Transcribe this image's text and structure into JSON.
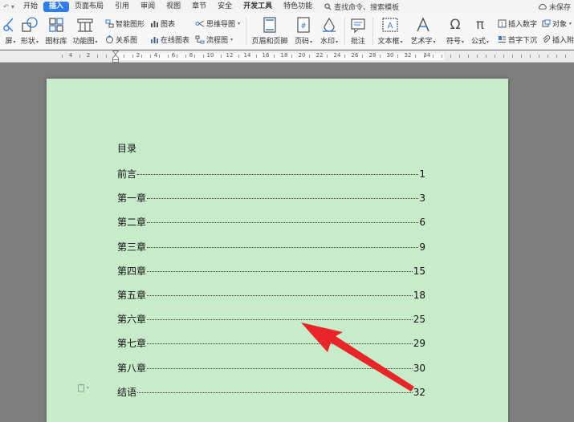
{
  "menubar": {
    "tabs": [
      "开始",
      "插入",
      "页面布局",
      "引用",
      "审阅",
      "视图",
      "章节",
      "安全",
      "开发工具",
      "特色功能"
    ],
    "active_tab": "插入",
    "search_placeholder": "查找命令、搜索模板",
    "save_state": "未保存"
  },
  "ribbon": {
    "screenshot": "屏",
    "shape": "形状",
    "icon_lib": "图标库",
    "func_chart": "功能图",
    "smart_art": "智能图形",
    "relation": "关系图",
    "chart": "图表",
    "online_chart": "在线图表",
    "mind_map": "思维导图",
    "flow_chart": "流程图",
    "header_footer": "页眉和页脚",
    "page_num": "页码",
    "watermark": "水印",
    "comment": "批注",
    "textbox": "文本框",
    "wordart": "艺术字",
    "symbol": "符号",
    "formula": "公式",
    "insert_number": "插入数字",
    "drop_cap": "首字下沉",
    "object": "对象",
    "insert_attach": "插入附"
  },
  "ruler": {
    "labels": [
      "4",
      "2",
      "2",
      "4",
      "6",
      "8",
      "10",
      "12",
      "14",
      "16",
      "18",
      "20",
      "22",
      "24",
      "26",
      "28",
      "30",
      "32",
      "34"
    ]
  },
  "document": {
    "toc_title": "目录",
    "entries": [
      {
        "chapter": "前言",
        "page": "1"
      },
      {
        "chapter": "第一章",
        "page": "3"
      },
      {
        "chapter": "第二章",
        "page": "6"
      },
      {
        "chapter": "第三章",
        "page": "9"
      },
      {
        "chapter": "第四章",
        "page": "15"
      },
      {
        "chapter": "第五章",
        "page": "18"
      },
      {
        "chapter": "第六章",
        "page": "25"
      },
      {
        "chapter": "第七章",
        "page": "29"
      },
      {
        "chapter": "第八章",
        "page": "30"
      },
      {
        "chapter": "结语",
        "page": "32"
      }
    ]
  },
  "colors": {
    "accent": "#2f7ceb",
    "page_background": "#c8ecc9",
    "workspace": "#7e7e7e",
    "annotation_arrow": "#e8262a"
  }
}
